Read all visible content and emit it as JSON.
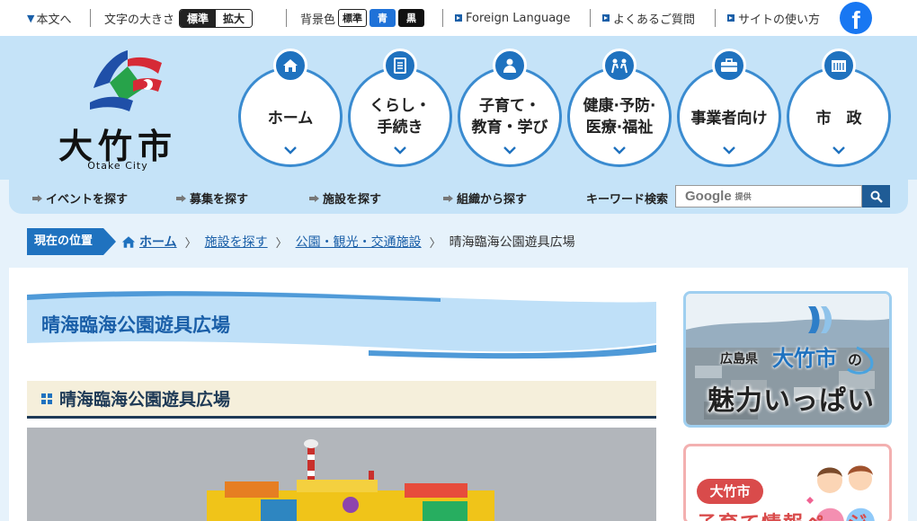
{
  "utility": {
    "skip": "本文へ",
    "font_size_label": "文字の大きさ",
    "font_normal": "標準",
    "font_large": "拡大",
    "bg_label": "背景色",
    "bg_normal": "標準",
    "bg_blue": "青",
    "bg_black": "黒",
    "foreign": "Foreign Language",
    "faq": "よくあるご質問",
    "howto": "サイトの使い方",
    "facebook": "f"
  },
  "logo": {
    "name": "大竹市",
    "en": "Otake City"
  },
  "global_nav": [
    {
      "label": "ホーム",
      "icon": "home-icon"
    },
    {
      "label": "くらし・\n手続き",
      "icon": "document-icon"
    },
    {
      "label": "子育て・\n教育・学び",
      "icon": "child-icon"
    },
    {
      "label": "健康·予防·\n医療·福祉",
      "icon": "health-icon"
    },
    {
      "label": "事業者向け",
      "icon": "briefcase-icon"
    },
    {
      "label": "市　政",
      "icon": "building-icon"
    }
  ],
  "sub_nav": {
    "event": "イベントを探す",
    "recruit": "募集を探す",
    "facility": "施設を探す",
    "org": "組織から探す",
    "keyword": "キーワード検索",
    "search_brand": "Google",
    "search_provided": "提供"
  },
  "breadcrumb": {
    "here": "現在の位置",
    "items": [
      "ホーム",
      "施設を探す",
      "公園・観光・交通施設"
    ],
    "current": "晴海臨海公園遊具広場"
  },
  "page": {
    "title": "晴海臨海公園遊具広場",
    "section_title": "晴海臨海公園遊具広場"
  },
  "banners": {
    "charm_pref": "広島県",
    "charm_city": "大竹市",
    "charm_no": "の",
    "charm_main": "魅力いっぱい",
    "kosodate_city": "大竹市",
    "kosodate_text": "子育て情報ページ"
  },
  "colors": {
    "accent": "#1f72bf",
    "header_bg": "#c5e3f8",
    "page_bg": "#e6f2fb"
  }
}
